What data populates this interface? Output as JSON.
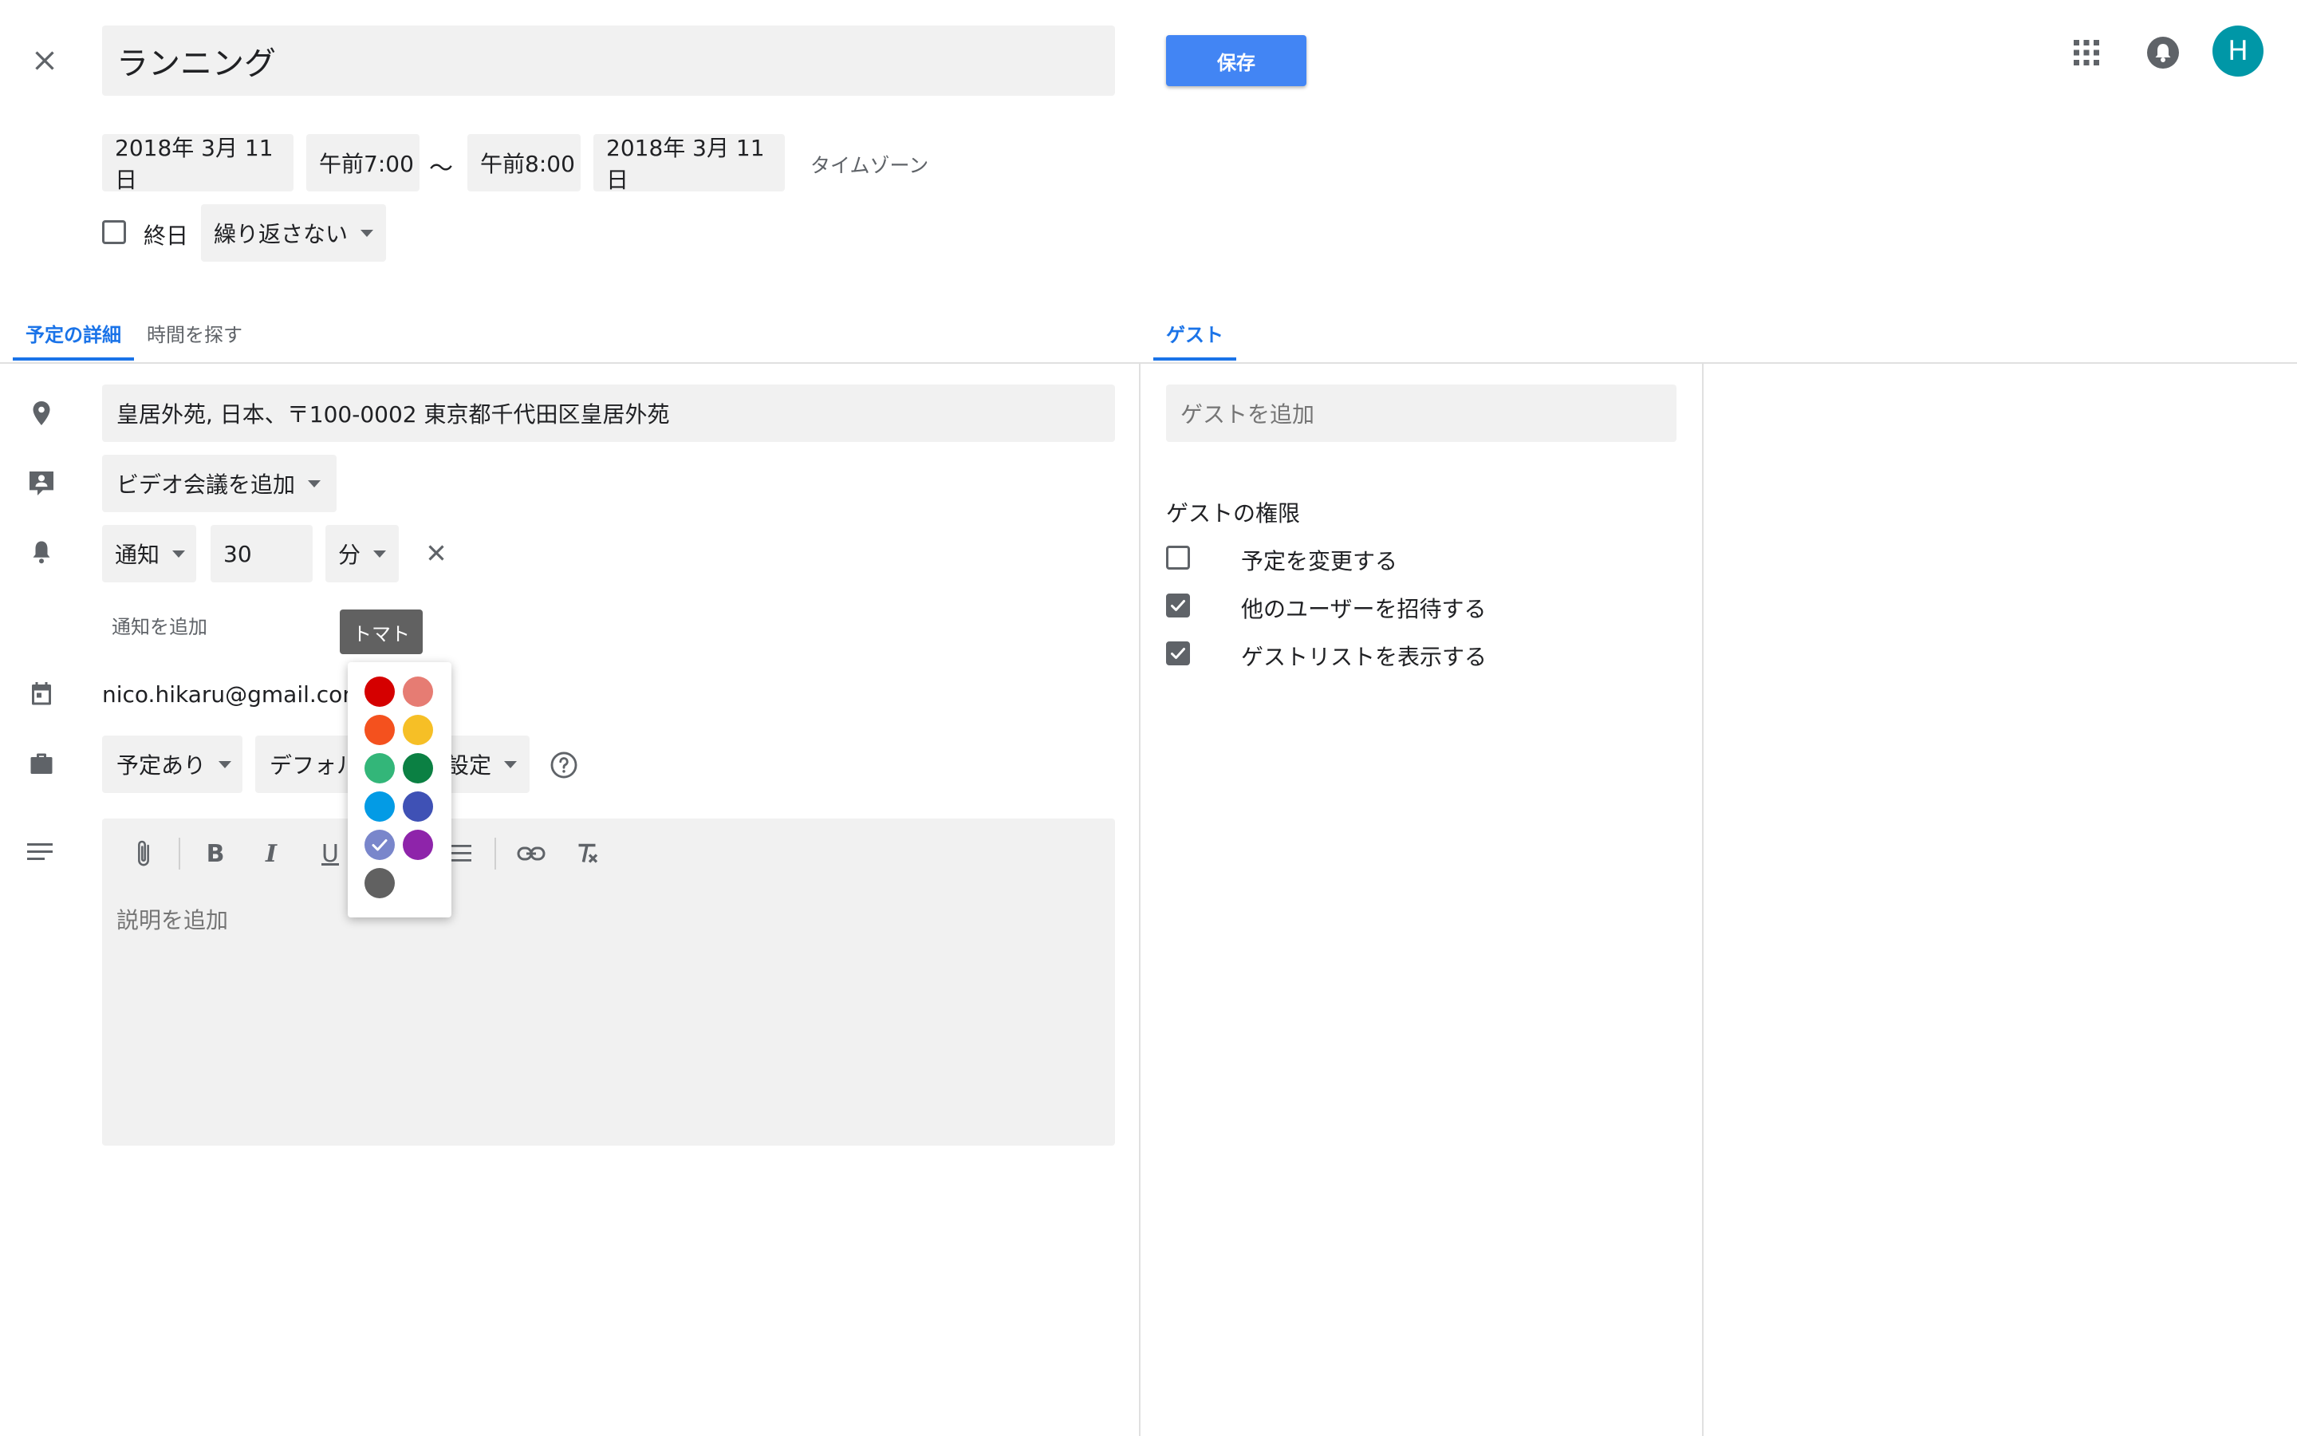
{
  "header": {
    "event_title": "ランニング",
    "save_label": "保存",
    "avatar_letter": "H"
  },
  "datetime": {
    "start_date": "2018年 3月 11日",
    "start_time": "午前7:00",
    "separator": "〜",
    "end_time": "午前8:00",
    "end_date": "2018年 3月 11日",
    "timezone_label": "タイムゾーン",
    "all_day_label": "終日",
    "repeat_label": "繰り返さない"
  },
  "tabs": {
    "details": "予定の詳細",
    "find_time": "時間を探す",
    "guests": "ゲスト"
  },
  "details": {
    "location": "皇居外苑, 日本、〒100-0002 東京都千代田区皇居外苑",
    "video_conference": "ビデオ会議を追加",
    "notification_type": "通知",
    "notification_value": "30",
    "notification_unit": "分",
    "add_notification": "通知を追加",
    "calendar_owner": "nico.hikaru@gmail.com",
    "availability": "予定あり",
    "visibility_prefix": "デフォル",
    "visibility_suffix": "設定",
    "description_placeholder": "説明を追加"
  },
  "color_picker": {
    "tooltip": "トマト",
    "selected_index": 8,
    "colors": [
      "#d50000",
      "#e67c73",
      "#f4511e",
      "#f6bf26",
      "#33b679",
      "#0b8043",
      "#039be5",
      "#3f51b5",
      "#7986cb",
      "#8e24aa",
      "#616161"
    ]
  },
  "guests": {
    "add_placeholder": "ゲストを追加",
    "permissions_title": "ゲストの権限",
    "permissions": [
      {
        "label": "予定を変更する",
        "checked": false
      },
      {
        "label": "他のユーザーを招待する",
        "checked": true
      },
      {
        "label": "ゲストリストを表示する",
        "checked": true
      }
    ]
  },
  "colors": {
    "accent": "#1a73e8",
    "save_button": "#4285f4",
    "avatar": "#0097a7",
    "field_bg": "#f1f1f1"
  }
}
